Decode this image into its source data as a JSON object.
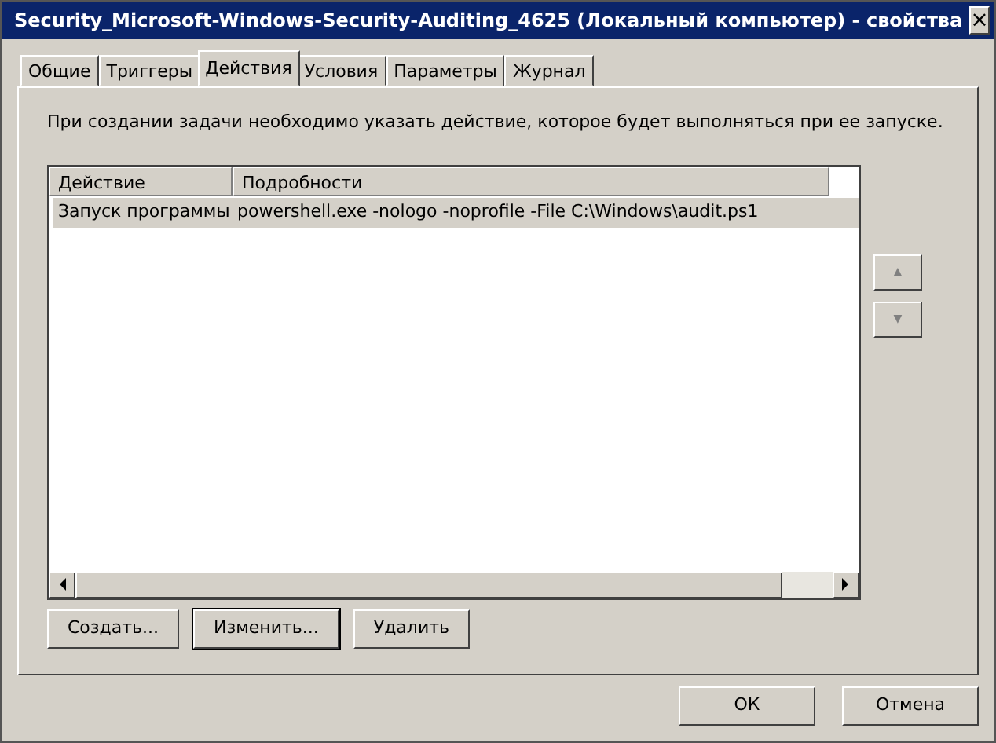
{
  "window": {
    "title": "Security_Microsoft-Windows-Security-Auditing_4625 (Локальный компьютер) - свойства",
    "close": "×"
  },
  "tabs": [
    {
      "label": "Общие",
      "selected": false
    },
    {
      "label": "Триггеры",
      "selected": false
    },
    {
      "label": "Действия",
      "selected": true
    },
    {
      "label": "Условия",
      "selected": false
    },
    {
      "label": "Параметры",
      "selected": false
    },
    {
      "label": "Журнал",
      "selected": false
    }
  ],
  "description": "При создании задачи необходимо указать действие, которое будет выполняться при ее запуске.",
  "table": {
    "columns": [
      "Действие",
      "Подробности"
    ],
    "rows": [
      {
        "cells": [
          "Запуск программы",
          "powershell.exe -nologo -noprofile -File C:\\Windows\\audit.ps1"
        ],
        "selected": true
      }
    ]
  },
  "move_buttons": [
    {
      "label": "▲",
      "disabled": true
    },
    {
      "label": "▼",
      "disabled": true
    }
  ],
  "action_buttons": [
    {
      "label": "Создать...",
      "default": false
    },
    {
      "label": "Изменить...",
      "default": true
    },
    {
      "label": "Удалить",
      "default": false
    }
  ],
  "dialog_buttons": [
    "ОК",
    "Отмена"
  ]
}
